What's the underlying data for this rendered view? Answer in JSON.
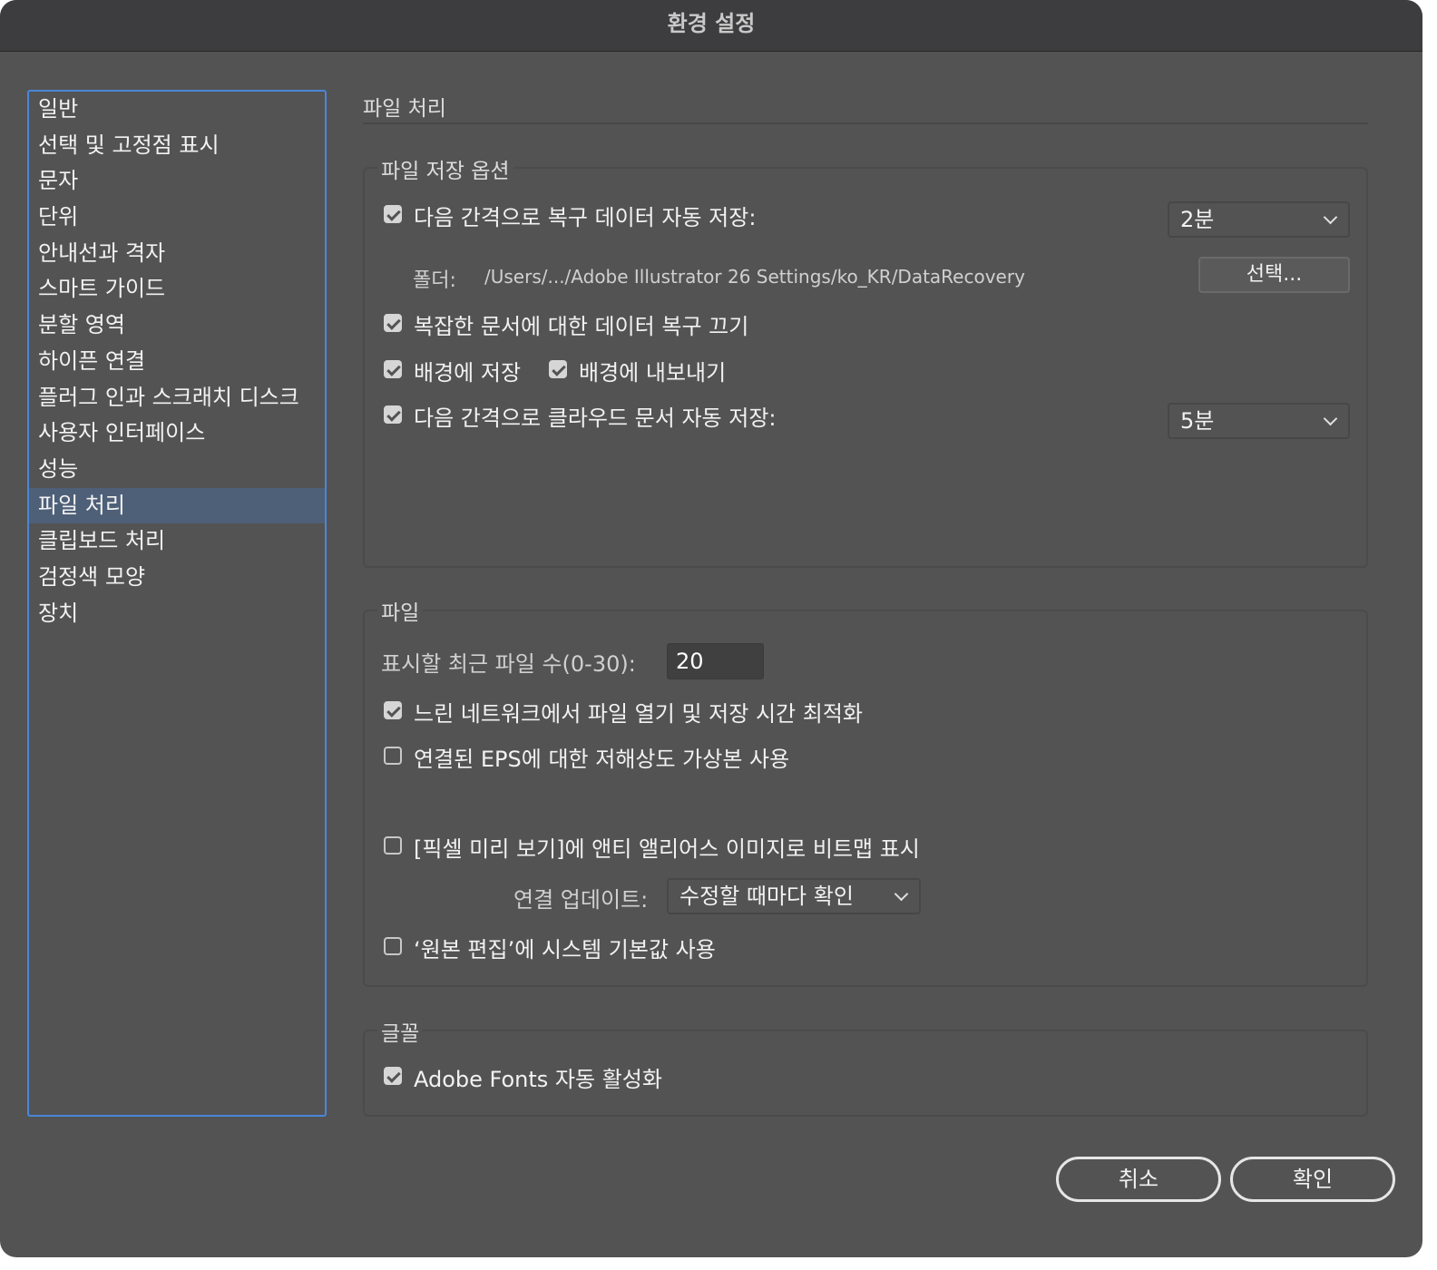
{
  "window": {
    "title": "환경 설정"
  },
  "sidebar": {
    "items": [
      {
        "label": "일반"
      },
      {
        "label": "선택 및 고정점 표시"
      },
      {
        "label": "문자"
      },
      {
        "label": "단위"
      },
      {
        "label": "안내선과 격자"
      },
      {
        "label": "스마트 가이드"
      },
      {
        "label": "분할 영역"
      },
      {
        "label": "하이픈 연결"
      },
      {
        "label": "플러그 인과 스크래치 디스크"
      },
      {
        "label": "사용자 인터페이스"
      },
      {
        "label": "성능"
      },
      {
        "label": "파일 처리"
      },
      {
        "label": "클립보드 처리"
      },
      {
        "label": "검정색 모양"
      },
      {
        "label": "장치"
      }
    ],
    "selected": "파일 처리"
  },
  "main": {
    "title": "파일 처리",
    "save_options": {
      "label": "파일 저장 옵션",
      "auto_save_recovery": {
        "label": "다음 간격으로 복구 데이터 자동 저장:",
        "checked": true,
        "interval": "2분"
      },
      "folder": {
        "label": "폴더:",
        "path": "/Users/.../Adobe Illustrator 26 Settings/ko_KR/DataRecovery",
        "choose_button": "선택..."
      },
      "disable_complex": {
        "label": "복잡한 문서에 대한 데이터 복구 끄기",
        "checked": true
      },
      "save_background": {
        "label": "배경에 저장",
        "checked": true
      },
      "export_background": {
        "label": "배경에 내보내기",
        "checked": true
      },
      "cloud_autosave": {
        "label": "다음 간격으로 클라우드 문서 자동 저장:",
        "checked": true,
        "interval": "5분"
      }
    },
    "files": {
      "label": "파일",
      "recent_count": {
        "label": "표시할 최근 파일 수(0-30):",
        "value": "20"
      },
      "slow_network": {
        "label": "느린 네트워크에서 파일 열기 및 저장 시간 최적화",
        "checked": true
      },
      "low_res_eps": {
        "label": "연결된 EPS에 대한 저해상도 가상본 사용",
        "checked": false
      },
      "antialias_bitmap": {
        "label": "[픽셀 미리 보기]에 앤티 앨리어스 이미지로 비트맵 표시",
        "checked": false
      },
      "link_update": {
        "label": "연결 업데이트:",
        "value": "수정할 때마다 확인"
      },
      "system_default": {
        "label": "‘원본 편집’에 시스템 기본값 사용",
        "checked": false
      }
    },
    "fonts": {
      "label": "글꼴",
      "auto_activate": {
        "label": "Adobe Fonts 자동 활성화",
        "checked": true
      }
    }
  },
  "footer": {
    "cancel_label": "취소",
    "ok_label": "확인"
  }
}
